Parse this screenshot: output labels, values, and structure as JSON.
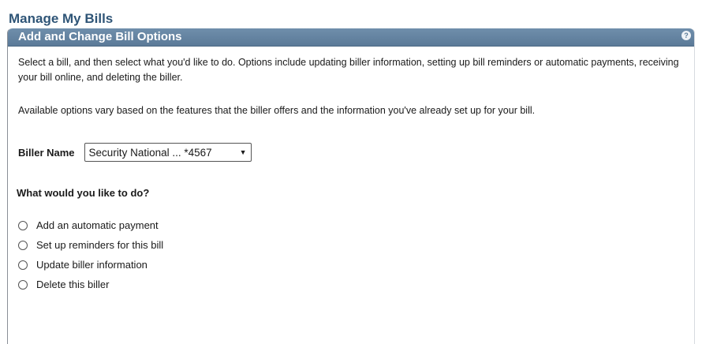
{
  "page": {
    "title": "Manage My Bills"
  },
  "panel": {
    "title": "Add and Change Bill Options",
    "help_icon": "?",
    "description_1": "Select a bill, and then select what you'd like to do. Options include updating biller information, setting up bill reminders or automatic payments, receiving your bill online, and deleting the biller.",
    "description_2": "Available options vary based on the features that the biller offers and the information you've already set up for your bill."
  },
  "biller": {
    "label": "Biller Name",
    "selected": "Security National ... *4567"
  },
  "question": "What would you like to do?",
  "options": [
    {
      "label": "Add an automatic payment",
      "selected": false
    },
    {
      "label": "Set up reminders for this bill",
      "selected": false
    },
    {
      "label": "Update biller information",
      "selected": false
    },
    {
      "label": "Delete this biller",
      "selected": false
    }
  ],
  "icons": {
    "help": "help-icon",
    "dropdown": "chevron-down-icon"
  },
  "colors": {
    "header": "#5b7a98",
    "title": "#2f5577"
  }
}
